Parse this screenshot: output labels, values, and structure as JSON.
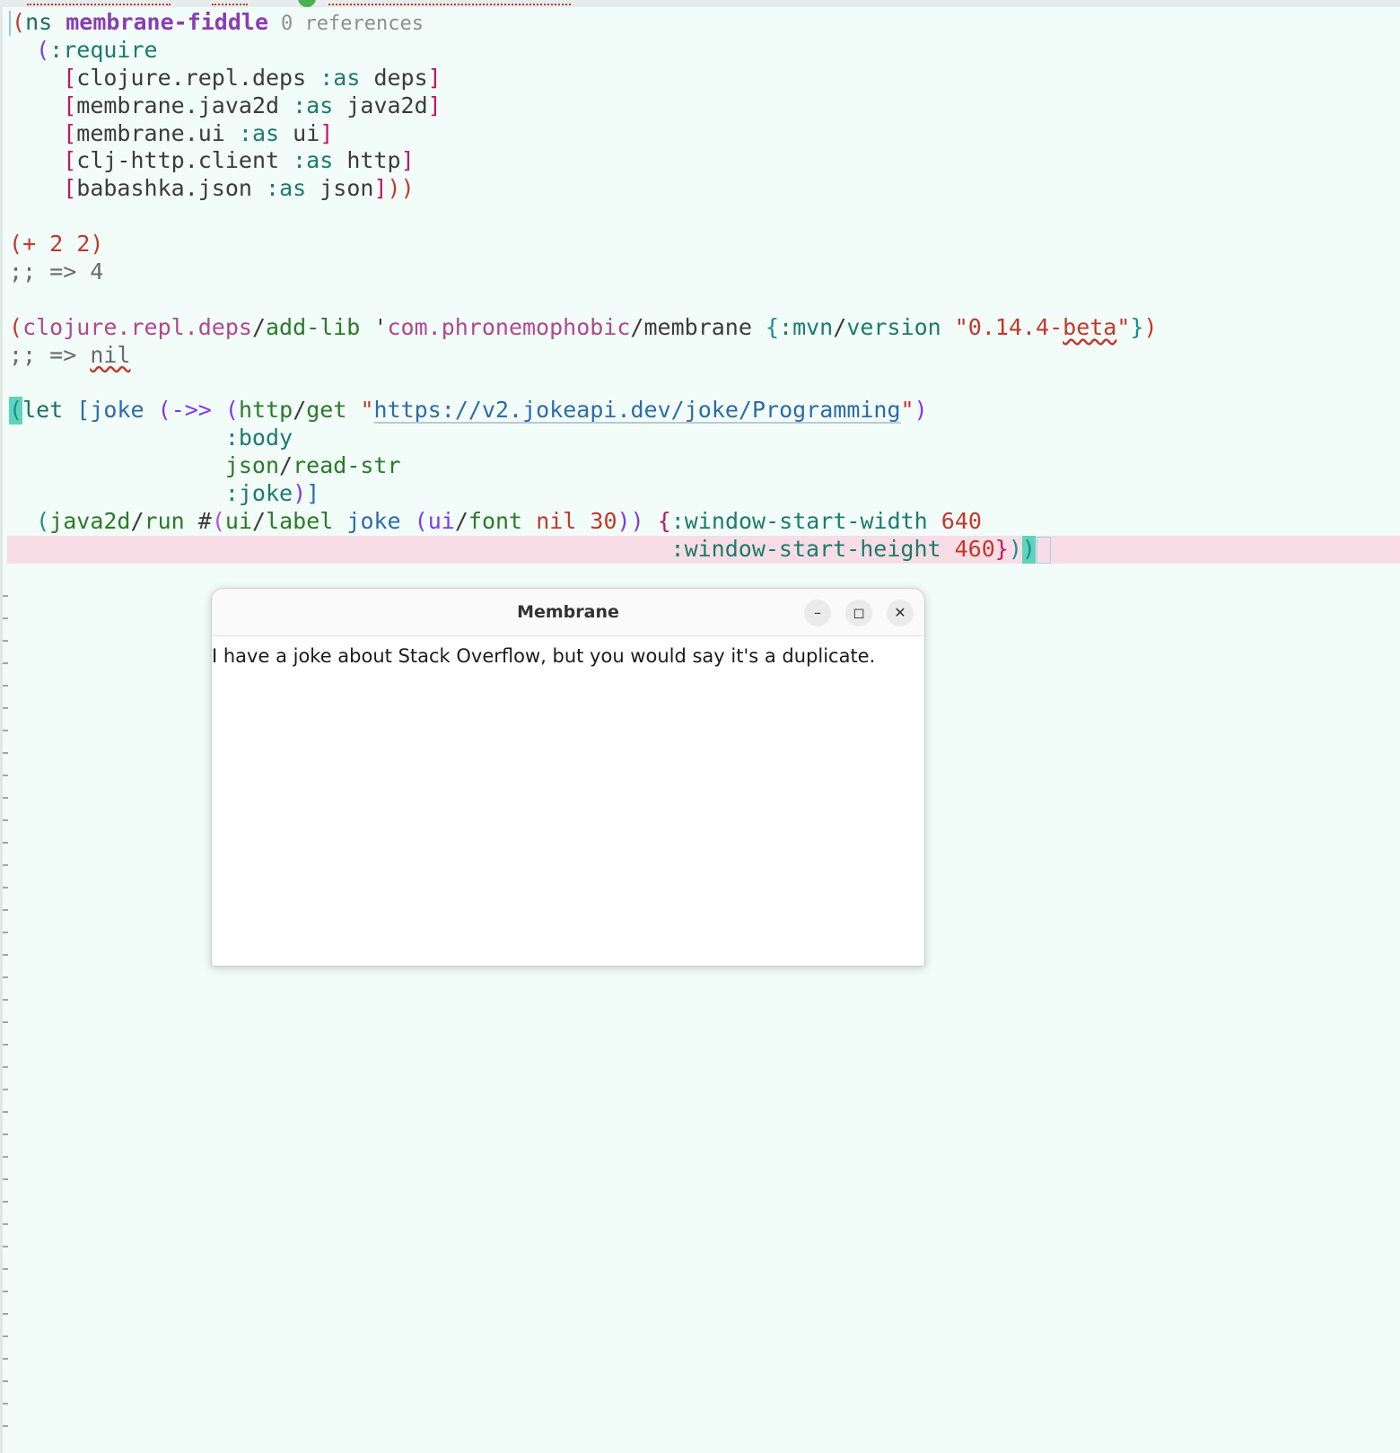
{
  "editor": {
    "lines": {
      "l1": {
        "open": "(",
        "ns": "ns",
        "name": "membrane-fiddle",
        "refs": "0 references"
      },
      "l2": {
        "open": "(",
        "require": ":require"
      },
      "l3": {
        "lb": "[",
        "lib": "clojure.repl.deps",
        "as": ":as",
        "alias": "deps",
        "rb": "]"
      },
      "l4": {
        "lb": "[",
        "lib": "membrane.java2d",
        "as": ":as",
        "alias": "java2d",
        "rb": "]"
      },
      "l5": {
        "lb": "[",
        "lib": "membrane.ui",
        "as": ":as",
        "alias": "ui",
        "rb": "]"
      },
      "l6": {
        "lb": "[",
        "lib": "clj-http.client",
        "as": ":as",
        "alias": "http",
        "rb": "]"
      },
      "l7": {
        "lb": "[",
        "lib": "babashka.json",
        "as": ":as",
        "alias": "json",
        "rb": "]",
        "close": "))"
      },
      "l9": {
        "open": "(",
        "op": "+",
        "a": "2",
        "b": "2",
        "close": ")"
      },
      "l10": {
        "comment": ";; => 4"
      },
      "l12": {
        "open": "(",
        "ns": "clojure.repl.deps",
        "slash": "/",
        "fn": "add-lib",
        "quote": "'",
        "group": "com.phronemophobic",
        "slash2": "/",
        "artifact": "membrane",
        "mopen": "{",
        "key_ns": ":mvn",
        "slash3": "/",
        "key": "version",
        "str_open": "\"",
        "version": "0.14.4-",
        "beta": "beta",
        "str_close": "\"",
        "mclose": "}",
        "close": ")"
      },
      "l13": {
        "comment": ";; => ",
        "nil": "nil"
      },
      "l15": {
        "open": "(",
        "let": "let",
        "vopen": "[",
        "joke": "joke",
        "topen": "(",
        "thread": "->>",
        "hopen": "(",
        "http": "http",
        "slash": "/",
        "get": "get",
        "q1": "\"",
        "url": "https://v2.jokeapi.dev/joke/Programming",
        "q2": "\"",
        "hclose": ")"
      },
      "l16": {
        "body": ":body"
      },
      "l17": {
        "json": "json",
        "slash": "/",
        "read": "read-str"
      },
      "l18": {
        "joke": ":joke",
        "close1": ")",
        "close2": "]"
      },
      "l19": {
        "open": "(",
        "java2d": "java2d",
        "slash": "/",
        "run": "run",
        "hash": "#",
        "fopen": "(",
        "ui": "ui",
        "slash2": "/",
        "label": "label",
        "joke": "joke",
        "ffopen": "(",
        "ui2": "ui",
        "slash3": "/",
        "font": "font",
        "nil": "nil",
        "size": "30",
        "ffclose": "))",
        "mopen": "{",
        "wkey": ":window-start-width",
        "wval": "640"
      },
      "l20": {
        "hkey": ":window-start-height",
        "hval": "460",
        "mclose": "}",
        "c1": ")",
        "c2": ")"
      }
    }
  },
  "window": {
    "title": "Membrane",
    "minimize_glyph": "–",
    "maximize_glyph": "◻",
    "close_glyph": "✕",
    "content": "I have a joke about Stack Overflow, but you would say it's a duplicate."
  }
}
